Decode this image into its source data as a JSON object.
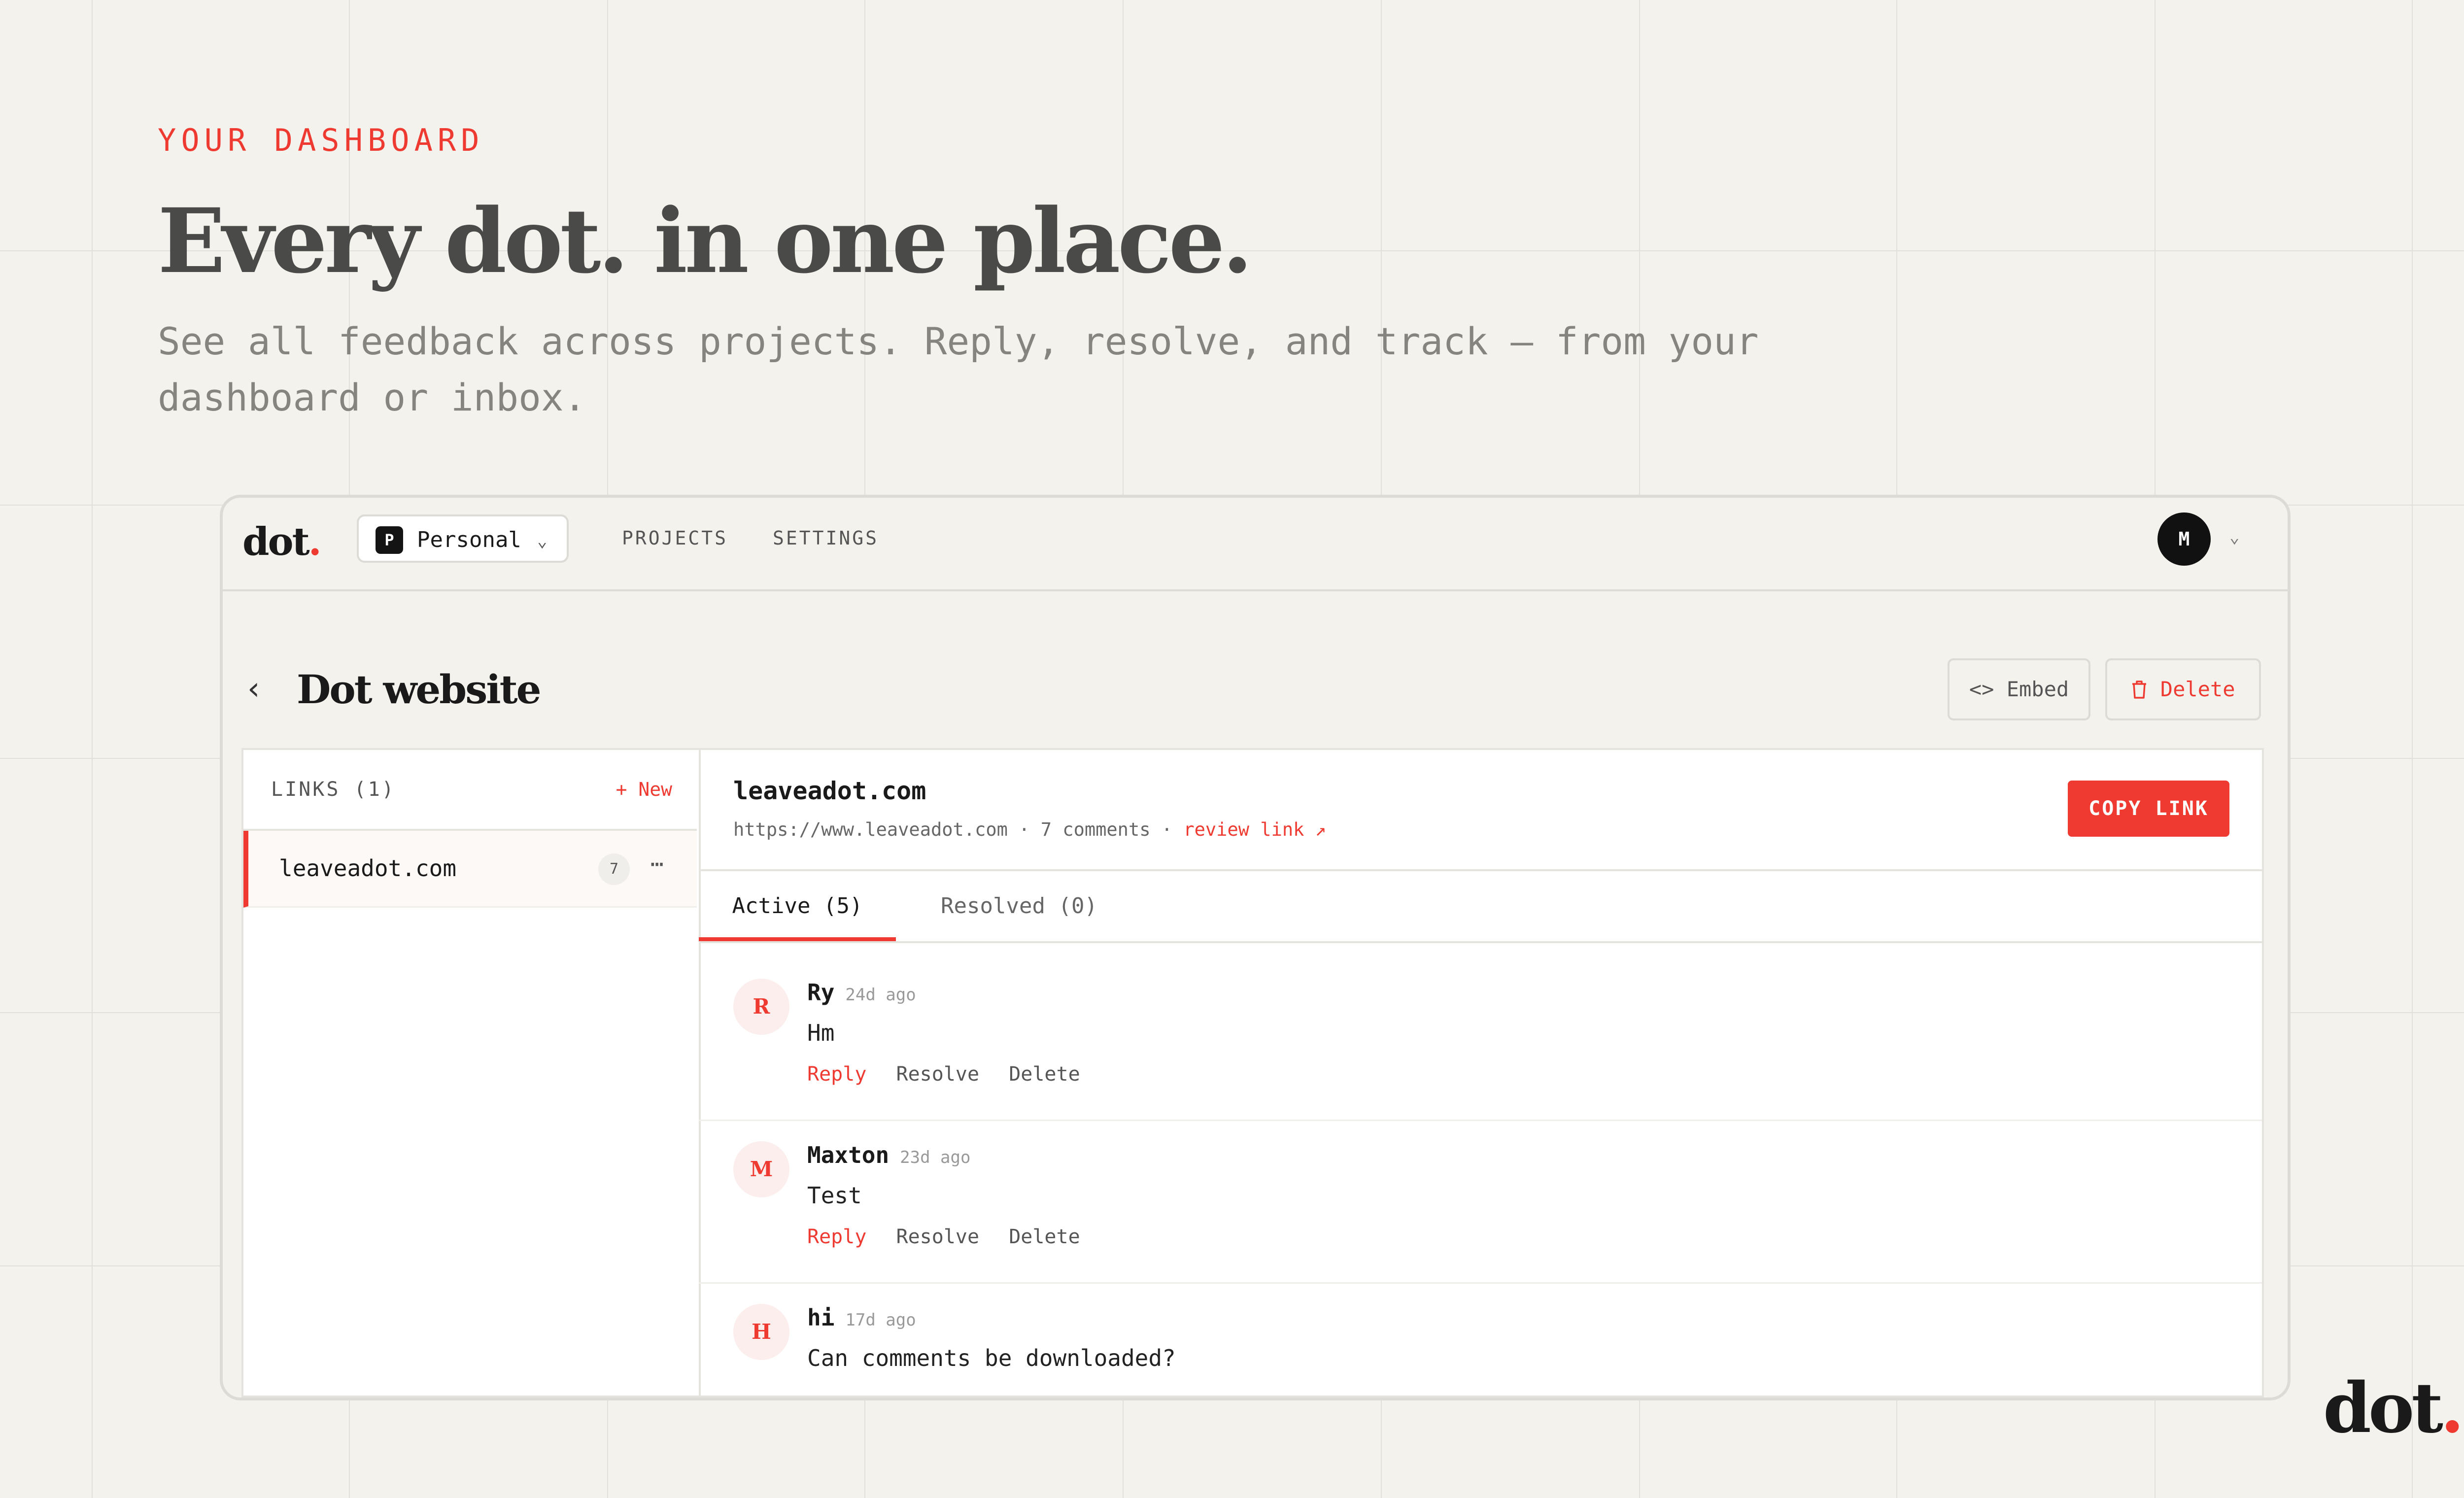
{
  "hero": {
    "eyebrow": "YOUR DASHBOARD",
    "headline": "Every dot. in one place.",
    "subtitle": "See all feedback across projects. Reply, resolve, and track — from your dashboard or inbox."
  },
  "app": {
    "logo": {
      "text": "dot",
      "dot": "."
    },
    "workspace": {
      "badge": "P",
      "label": "Personal"
    },
    "nav": [
      {
        "label": "PROJECTS"
      },
      {
        "label": "SETTINGS"
      }
    ],
    "user": {
      "initial": "M"
    },
    "project": {
      "title": "Dot website",
      "embed_label": "Embed",
      "delete_label": "Delete"
    },
    "sidebar": {
      "links_label": "LINKS (1)",
      "new_label": "+ New",
      "items": [
        {
          "name": "leaveadot.com",
          "count": "7",
          "more": "⋯"
        }
      ]
    },
    "link_detail": {
      "title": "leaveadot.com",
      "url": "https://www.leaveadot.com",
      "comments_count": "7 comments",
      "review_label": "review link ↗",
      "copy_label": "COPY LINK"
    },
    "tabs": [
      {
        "label": "Active (5)"
      },
      {
        "label": "Resolved (0)"
      }
    ],
    "comments": [
      {
        "initial": "R",
        "author": "Ry",
        "time": "24d ago",
        "text": "Hm",
        "reply": "Reply",
        "resolve": "Resolve",
        "delete": "Delete"
      },
      {
        "initial": "M",
        "author": "Maxton",
        "time": "23d ago",
        "text": "Test",
        "reply": "Reply",
        "resolve": "Resolve",
        "delete": "Delete"
      },
      {
        "initial": "H",
        "author": "hi",
        "time": "17d ago",
        "text": "Can comments be downloaded?"
      }
    ]
  },
  "brand_logo": {
    "text": "dot",
    "dot": "."
  },
  "colors": {
    "accent": "#ee3a30",
    "background": "#f3f2ed",
    "text": "#1a1a1a"
  }
}
